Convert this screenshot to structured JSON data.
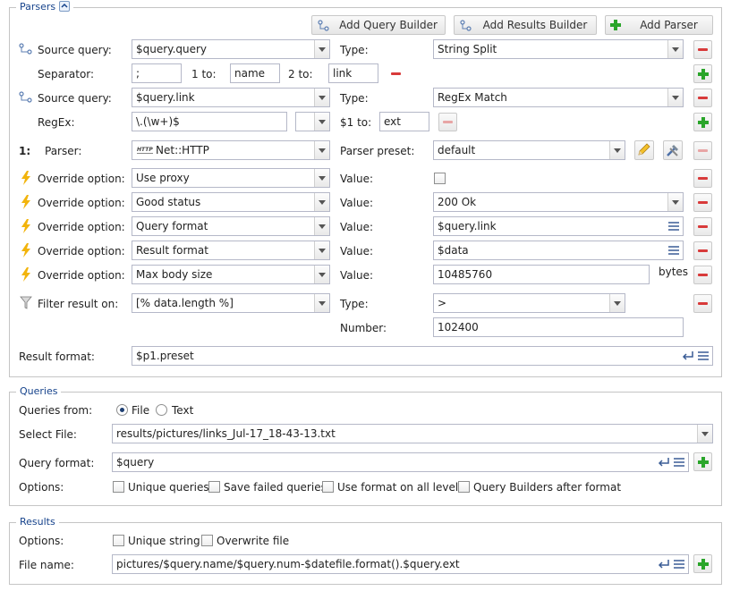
{
  "parsers": {
    "legend": "Parsers",
    "toolbar": {
      "add_query_builder": "Add Query Builder",
      "add_results_builder": "Add Results Builder",
      "add_parser": "Add Parser"
    },
    "source1": {
      "label": "Source query:",
      "value": "$query.query",
      "type_label": "Type:",
      "type_value": "String Split"
    },
    "split": {
      "separator_label": "Separator:",
      "separator_value": ";",
      "to1_label": "1 to:",
      "to1_value": "name",
      "to2_label": "2 to:",
      "to2_value": "link"
    },
    "source2": {
      "label": "Source query:",
      "value": "$query.link",
      "type_label": "Type:",
      "type_value": "RegEx Match"
    },
    "regex": {
      "label": "RegEx:",
      "value": "\\.(\\w+)$",
      "to1_label": "$1 to:",
      "to1_value": "ext"
    },
    "parser": {
      "index": "1:",
      "label": "Parser:",
      "value": "Net::HTTP",
      "badge": "HTTP",
      "preset_label": "Parser preset:",
      "preset_value": "default"
    },
    "overrides": [
      {
        "label": "Override option:",
        "option": "Use proxy",
        "value_label": "Value:",
        "value": ""
      },
      {
        "label": "Override option:",
        "option": "Good status",
        "value_label": "Value:",
        "value": "200 Ok"
      },
      {
        "label": "Override option:",
        "option": "Query format",
        "value_label": "Value:",
        "value": "$query.link"
      },
      {
        "label": "Override option:",
        "option": "Result format",
        "value_label": "Value:",
        "value": "$data"
      },
      {
        "label": "Override option:",
        "option": "Max body size",
        "value_label": "Value:",
        "value": "10485760",
        "unit": "bytes"
      }
    ],
    "filter": {
      "label": "Filter result on:",
      "value": "[% data.length %]",
      "type_label": "Type:",
      "type_value": ">",
      "number_label": "Number:",
      "number_value": "102400"
    },
    "result_format": {
      "label": "Result format:",
      "value": "$p1.preset"
    }
  },
  "queries": {
    "legend": "Queries",
    "from_label": "Queries from:",
    "from_file": "File",
    "from_text": "Text",
    "select_file_label": "Select File:",
    "select_file_value": "results/pictures/links_Jul-17_18-43-13.txt",
    "query_format_label": "Query format:",
    "query_format_value": "$query",
    "options_label": "Options:",
    "options": [
      "Unique queries",
      "Save failed queries",
      "Use format on all levels",
      "Query Builders after format"
    ]
  },
  "results": {
    "legend": "Results",
    "options_label": "Options:",
    "options": [
      "Unique string",
      "Overwrite file"
    ],
    "file_name_label": "File name:",
    "file_name_value": "pictures/$query.name/$query.num-$datefile.format().$query.ext"
  },
  "colors": {
    "legend": "#15428b",
    "remove": "#d83a3a",
    "add": "#2aa52a",
    "lightning": "#f2b40c"
  }
}
